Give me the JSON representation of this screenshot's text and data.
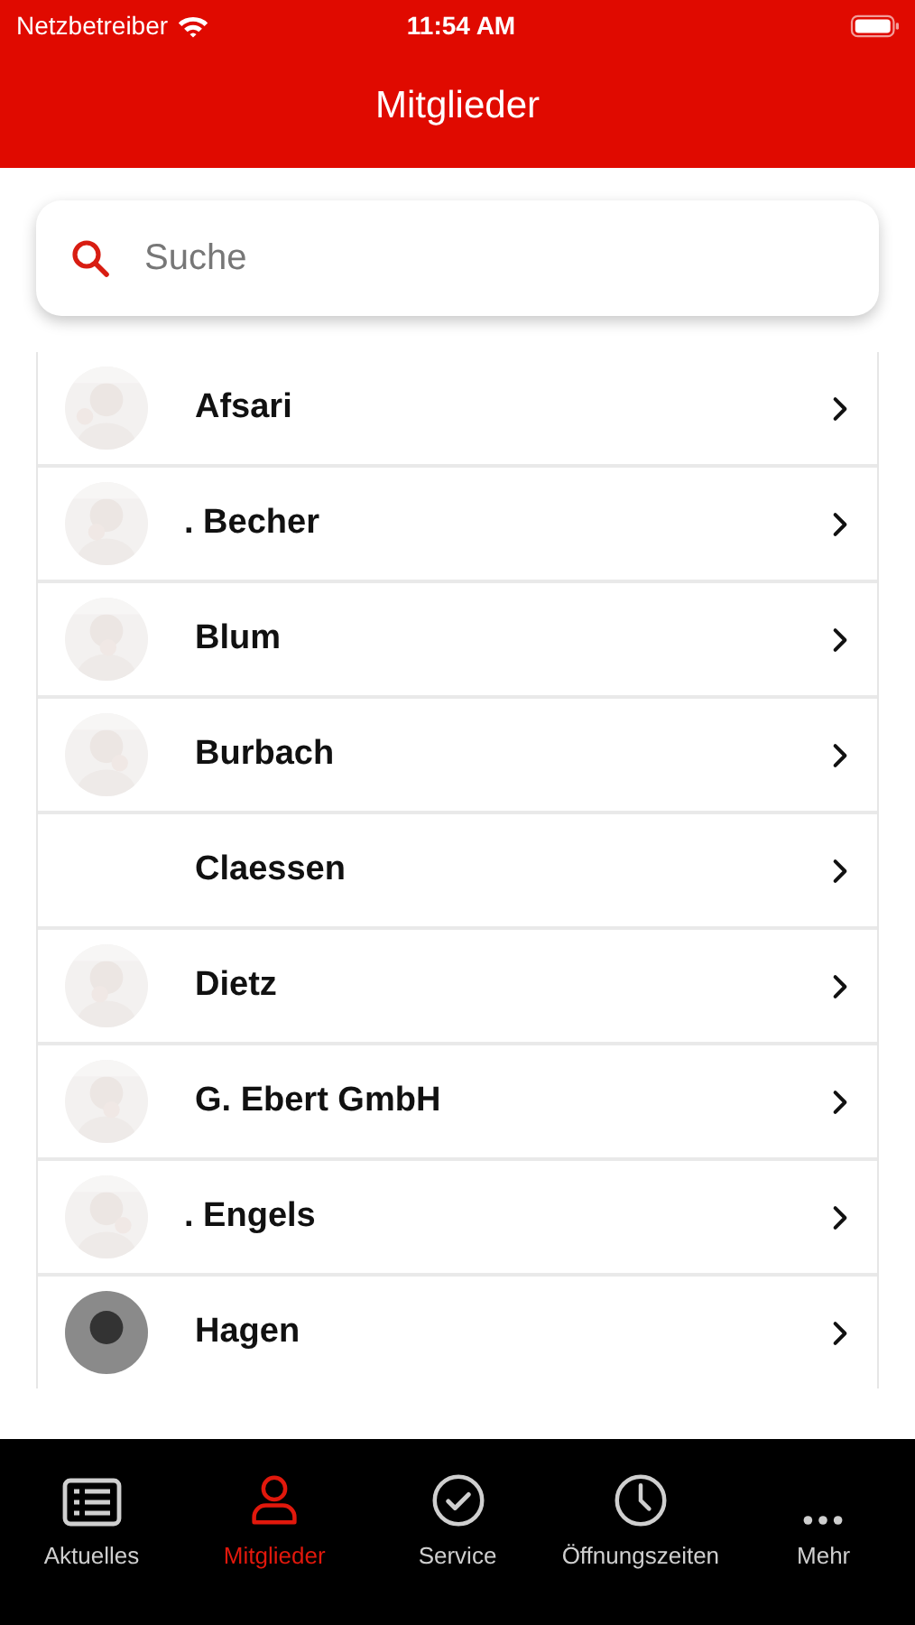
{
  "status_bar": {
    "carrier": "Netzbetreiber",
    "time": "11:54 AM"
  },
  "header": {
    "title": "Mitglieder"
  },
  "search": {
    "placeholder": "Suche"
  },
  "members": [
    {
      "name": "Afsari"
    },
    {
      "name": ". Becher"
    },
    {
      "name": "Blum"
    },
    {
      "name": "Burbach"
    },
    {
      "name": "Claessen",
      "kind": "blank"
    },
    {
      "name": "Dietz"
    },
    {
      "name": "G. Ebert GmbH"
    },
    {
      "name": ". Engels"
    },
    {
      "name": "Hagen",
      "kind": "silhouette"
    }
  ],
  "tabs": [
    {
      "label": "Aktuelles",
      "selected": false
    },
    {
      "label": "Mitglieder",
      "selected": true
    },
    {
      "label": "Service",
      "selected": false
    },
    {
      "label": "Öffnungszeiten",
      "selected": false
    },
    {
      "label": "Mehr",
      "selected": false
    }
  ]
}
